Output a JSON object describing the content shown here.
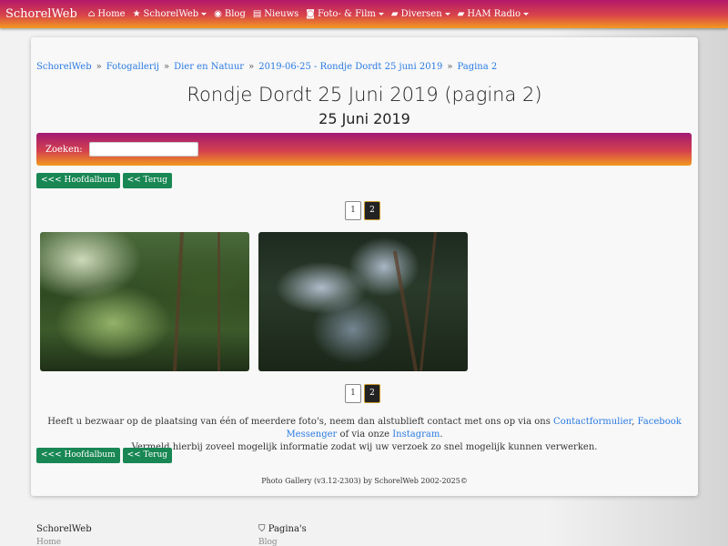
{
  "navbar": {
    "brand": "SchorelWeb",
    "items": [
      {
        "label": "Home",
        "icon": "home-icon",
        "glyph": "⌂",
        "dropdown": false
      },
      {
        "label": "SchorelWeb",
        "icon": "star-icon",
        "glyph": "★",
        "dropdown": true
      },
      {
        "label": "Blog",
        "icon": "rss-icon",
        "glyph": "◉",
        "dropdown": false
      },
      {
        "label": "Nieuws",
        "icon": "newspaper-icon",
        "glyph": "▤",
        "dropdown": false
      },
      {
        "label": "Foto- & Film",
        "icon": "camera-icon",
        "glyph": "◙",
        "dropdown": true
      },
      {
        "label": "Diversen",
        "icon": "folder-icon",
        "glyph": "▰",
        "dropdown": true
      },
      {
        "label": "HAM Radio",
        "icon": "folder-icon",
        "glyph": "▰",
        "dropdown": true
      }
    ]
  },
  "breadcrumb": [
    "SchorelWeb",
    "Fotogallerij",
    "Dier en Natuur",
    "2019-06-25 - Rondje Dordt 25 juni 2019",
    "Pagina 2"
  ],
  "page": {
    "title": "Rondje Dordt 25 Juni 2019 (pagina 2)",
    "subtitle": "25 Juni 2019"
  },
  "search": {
    "label": "Zoeken:",
    "value": ""
  },
  "buttons": {
    "main_album": "<<< Hoofdalbum",
    "back": "<< Terug"
  },
  "pagination": {
    "pages": [
      "1",
      "2"
    ],
    "active": "2"
  },
  "notice": {
    "part1": "Heeft u bezwaar op de plaatsing van één of meerdere foto's, neem dan alstublieft contact met ons op via ons ",
    "link1": "Contactformulier",
    "sep1": ", ",
    "link2": "Facebook Messenger",
    "part2": " of via onze ",
    "link3": "Instagram",
    "part3": ".",
    "line2": "Vermeld hierbij zoveel mogelijk informatie zodat wij uw verzoek zo snel mogelijk kunnen verwerken."
  },
  "credit": "Photo Gallery (v3.12-2303) by SchorelWeb 2002-2025©",
  "footer": {
    "col1_title": "SchorelWeb",
    "col1_item": "Home",
    "col2_title": "Pagina's",
    "col2_item": "Blog"
  },
  "colors": {
    "accent_button": "#198754",
    "link": "#2a7ae2",
    "gradient_top": "#b3186a",
    "gradient_bottom": "#f29a1f"
  }
}
